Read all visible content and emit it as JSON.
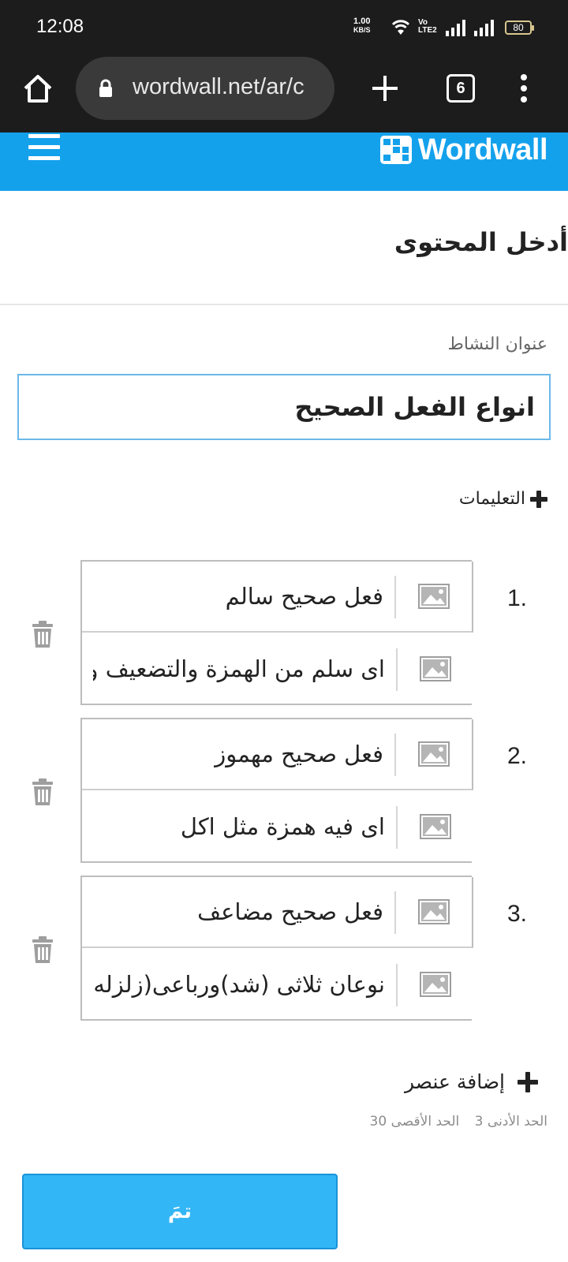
{
  "status_bar": {
    "time": "12:08",
    "net_speed_value": "1.00",
    "net_speed_unit": "KB/S",
    "volte_top": "Vo",
    "volte_bottom": "LTE2",
    "battery": "80"
  },
  "browser": {
    "url": "wordwall.net/ar/c",
    "tab_count": "6",
    "icons": [
      "home-icon",
      "lock-icon",
      "plus-icon",
      "tabs-icon",
      "more-vert-icon"
    ]
  },
  "header": {
    "logo_text": "Wordwall",
    "brand_color": "#14a1ec"
  },
  "page": {
    "title": "أدخل المحتوى",
    "activity_title_label": "عنوان النشاط",
    "activity_title_value": "انواع الفعل الصحيح",
    "instructions_label": "التعليمات"
  },
  "items": [
    {
      "number": "1.",
      "keyword": "فعل صحيح سالم",
      "definition": "اى سلم من الهمزة والتضعيف و"
    },
    {
      "number": "2.",
      "keyword": "فعل صحيح مهموز",
      "definition": "اى فيه همزة مثل اكل"
    },
    {
      "number": "3.",
      "keyword": "فعل صحيح مضاعف",
      "definition": "نوعان ثلاثى (شد)ورباعى(زلزله"
    }
  ],
  "footer": {
    "add_item_label": "إضافة عنصر",
    "min_label": "الحد الأدنى 3",
    "max_label": "الحد الأقصى 30",
    "done_label": "تمَ"
  }
}
